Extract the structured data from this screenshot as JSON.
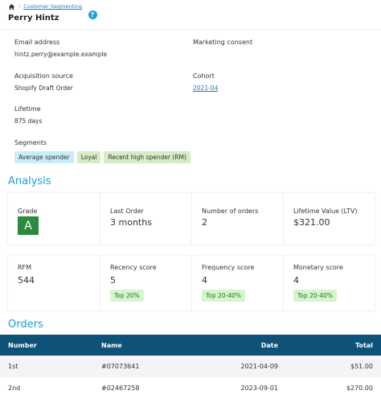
{
  "breadcrumb": {
    "link": "Customer Segmenting"
  },
  "customer": {
    "name": "Perry Hintz",
    "email_label": "Email address",
    "email": "hintz.perry@example.example",
    "consent_label": "Marketing consent",
    "source_label": "Acquisition source",
    "source": "Shopify Draft Order",
    "cohort_label": "Cohort",
    "cohort": "2021-04",
    "lifetime_label": "Lifetime",
    "lifetime": "875 days",
    "segments_label": "Segments",
    "segments": [
      "Average spender",
      "Loyal",
      "Recent high spender (RM)"
    ]
  },
  "analysis": {
    "title": "Analysis",
    "grade_label": "Grade",
    "grade": "A",
    "last_order_label": "Last Order",
    "last_order": "3 months",
    "num_orders_label": "Number of orders",
    "num_orders": "2",
    "ltv_label": "Lifetime Value (LTV)",
    "ltv": "$321.00",
    "rfm_label": "RFM",
    "rfm": "544",
    "recency_label": "Recency score",
    "recency": "5",
    "recency_badge": "Top 20%",
    "frequency_label": "Frequency score",
    "frequency": "4",
    "frequency_badge": "Top 20-40%",
    "monetary_label": "Monetary score",
    "monetary": "4",
    "monetary_badge": "Top 20-40%"
  },
  "orders": {
    "title": "Orders",
    "columns": [
      "Number",
      "Name",
      "Date",
      "Total"
    ],
    "rows": [
      {
        "number": "1st",
        "name": "#07073641",
        "date": "2021-04-09",
        "total": "$51.00"
      },
      {
        "number": "2nd",
        "name": "#02467258",
        "date": "2023-09-01",
        "total": "$270.00"
      }
    ]
  },
  "colors": {
    "accent": "#1a9fd9",
    "header": "#0e5278",
    "grade": "#2a8a3e"
  },
  "icons": {
    "home": "home-icon",
    "help": "help-icon"
  }
}
